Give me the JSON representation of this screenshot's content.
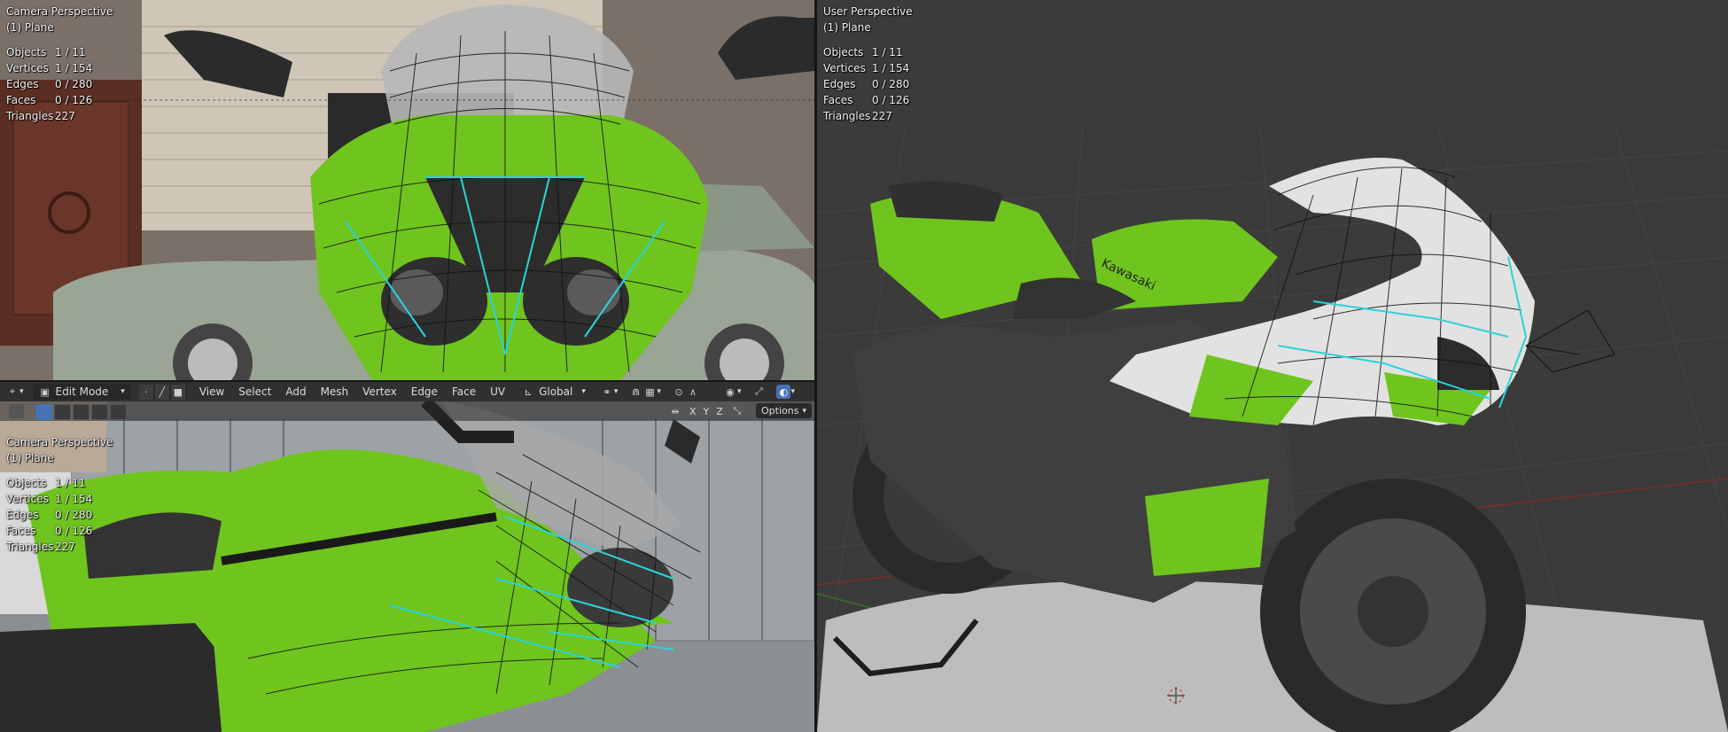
{
  "viewports": {
    "top_left": {
      "view": "Camera Perspective",
      "object": "(1) Plane",
      "stats": [
        {
          "label": "Objects",
          "value": "1 / 11"
        },
        {
          "label": "Vertices",
          "value": "1 / 154"
        },
        {
          "label": "Edges",
          "value": "0 / 280"
        },
        {
          "label": "Faces",
          "value": "0 / 126"
        },
        {
          "label": "Triangles",
          "value": "227"
        }
      ]
    },
    "bottom_left": {
      "view": "Camera Perspective",
      "object": "(1) Plane",
      "stats": [
        {
          "label": "Objects",
          "value": "1 / 11"
        },
        {
          "label": "Vertices",
          "value": "1 / 154"
        },
        {
          "label": "Edges",
          "value": "0 / 280"
        },
        {
          "label": "Faces",
          "value": "0 / 126"
        },
        {
          "label": "Triangles",
          "value": "227"
        }
      ]
    },
    "right": {
      "view": "User Perspective",
      "object": "(1) Plane",
      "stats": [
        {
          "label": "Objects",
          "value": "1 / 11"
        },
        {
          "label": "Vertices",
          "value": "1 / 154"
        },
        {
          "label": "Edges",
          "value": "0 / 280"
        },
        {
          "label": "Faces",
          "value": "0 / 126"
        },
        {
          "label": "Triangles",
          "value": "227"
        }
      ]
    }
  },
  "header": {
    "mode": "Edit Mode",
    "menus": [
      "View",
      "Select",
      "Add",
      "Mesh",
      "Vertex",
      "Edge",
      "Face",
      "UV"
    ],
    "transform_orientation": "Global"
  },
  "toolbar": {
    "axes": [
      "X",
      "Y",
      "Z"
    ],
    "options_label": "Options"
  },
  "colors": {
    "accent": "#4772b3",
    "mesh_edge": "#111111",
    "seam": "#2bd3d8",
    "bike_green": "#6fc41e"
  }
}
